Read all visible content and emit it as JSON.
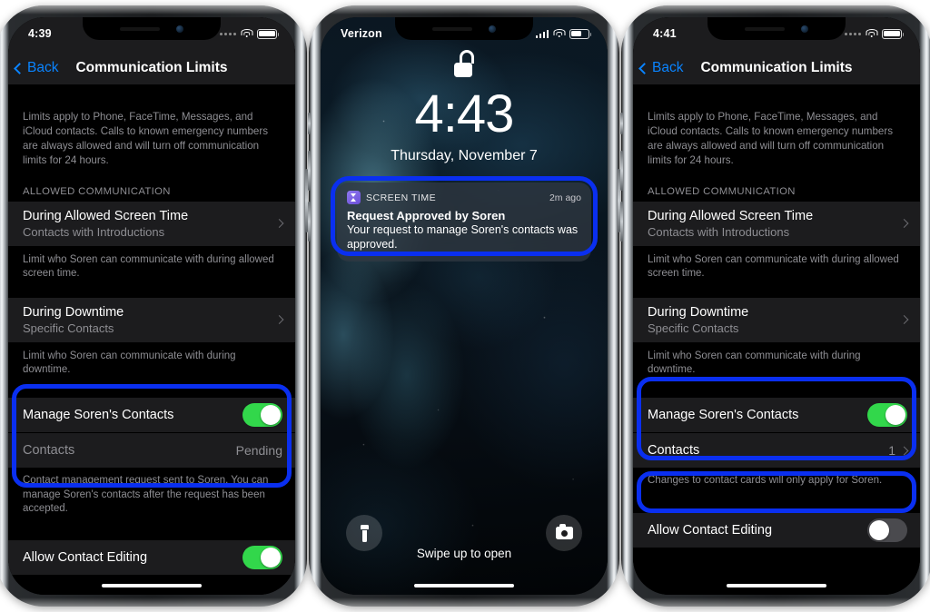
{
  "phones": [
    {
      "id": "phone-left",
      "type": "settings",
      "status": {
        "time": "4:39",
        "carrier": "",
        "signal": "dots",
        "wifi": "wifi-icon",
        "battery_full": true
      },
      "nav": {
        "back": "Back",
        "title": "Communication Limits"
      },
      "blurb": "Limits apply to Phone, FaceTime, Messages, and iCloud contacts. Calls to known emergency numbers are always allowed and will turn off communication limits for 24 hours.",
      "section_header": "ALLOWED COMMUNICATION",
      "cells": [
        {
          "title": "During Allowed Screen Time",
          "subtitle": "Contacts with Introductions",
          "footer": "Limit who Soren can communicate with during allowed screen time."
        },
        {
          "title": "During Downtime",
          "subtitle": "Specific Contacts",
          "footer": "Limit who Soren can communicate with during downtime."
        }
      ],
      "manage_group": {
        "toggle_label": "Manage Soren's Contacts",
        "toggle_state": "on",
        "row_label": "Contacts",
        "row_value": "Pending",
        "row_has_chevron": false,
        "footer": "Contact management request sent to Soren. You can manage Soren's contacts after the request has been accepted.",
        "highlighted": true
      },
      "editing_row": {
        "label": "Allow Contact Editing",
        "toggle_state": "on",
        "highlighted": false
      }
    },
    {
      "id": "phone-middle",
      "type": "lockscreen",
      "status": {
        "time": "",
        "carrier": "Verizon",
        "signal": "bars",
        "wifi": "wifi-icon",
        "battery_full": false
      },
      "lock_icon": "unlocked-padlock-icon",
      "clock": "4:43",
      "date": "Thursday, November 7",
      "notification": {
        "app": "SCREEN TIME",
        "app_icon": "hourglass-icon",
        "time": "2m ago",
        "title": "Request Approved by Soren",
        "body": "Your request to manage Soren's contacts was approved.",
        "highlighted": true
      },
      "bottom": {
        "flashlight": "flashlight-icon",
        "camera": "camera-icon",
        "hint": "Swipe up to open"
      }
    },
    {
      "id": "phone-right",
      "type": "settings",
      "status": {
        "time": "4:41",
        "carrier": "",
        "signal": "dots",
        "wifi": "wifi-icon",
        "battery_full": true
      },
      "nav": {
        "back": "Back",
        "title": "Communication Limits"
      },
      "blurb": "Limits apply to Phone, FaceTime, Messages, and iCloud contacts. Calls to known emergency numbers are always allowed and will turn off communication limits for 24 hours.",
      "section_header": "ALLOWED COMMUNICATION",
      "cells": [
        {
          "title": "During Allowed Screen Time",
          "subtitle": "Contacts with Introductions",
          "footer": "Limit who Soren can communicate with during allowed screen time."
        },
        {
          "title": "During Downtime",
          "subtitle": "Specific Contacts",
          "footer": "Limit who Soren can communicate with during downtime."
        }
      ],
      "manage_group": {
        "toggle_label": "Manage Soren's Contacts",
        "toggle_state": "on",
        "row_label": "Contacts",
        "row_value": "1",
        "row_has_chevron": true,
        "footer": "Changes to contact cards will only apply for Soren.",
        "highlighted": true
      },
      "editing_row": {
        "label": "Allow Contact Editing",
        "toggle_state": "off",
        "highlighted": true
      }
    }
  ],
  "colors": {
    "highlight_blue": "#0a2ff0",
    "toggle_on_green": "#32d74b",
    "toggle_off_gray": "#4a4a4e",
    "accent_blue": "#0a84ff",
    "cell_bg": "#1c1c1e",
    "secondary_text": "#8e8e93",
    "screentime_purple": "#7b5ce0"
  }
}
